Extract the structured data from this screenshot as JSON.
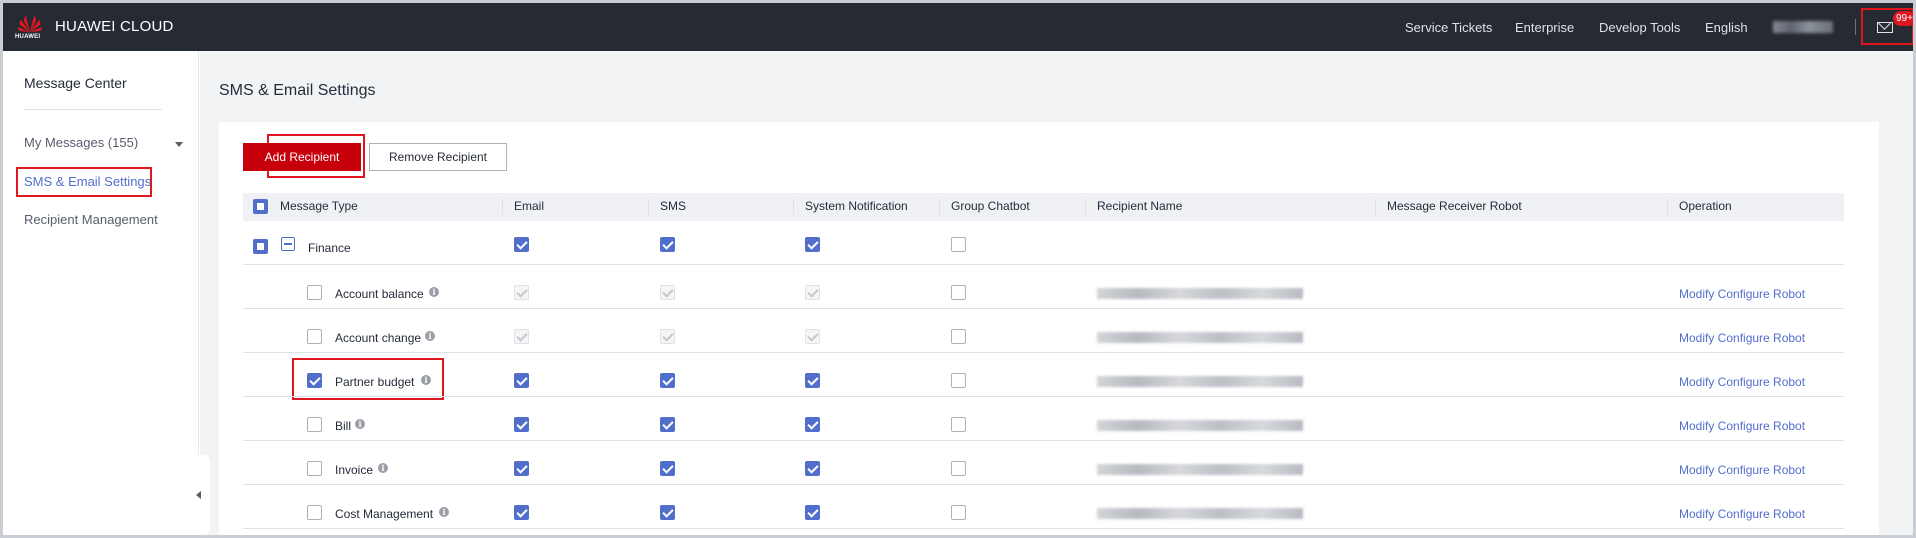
{
  "topbar": {
    "brand": "HUAWEI CLOUD",
    "logo_sub": "HUAWEI",
    "nav": [
      "Service Tickets",
      "Enterprise",
      "Develop Tools",
      "English"
    ],
    "mail_badge": "99+"
  },
  "sidebar": {
    "title": "Message Center",
    "items": [
      {
        "label": "My Messages (155)"
      },
      {
        "label": "SMS & Email Settings"
      },
      {
        "label": "Recipient Management"
      }
    ]
  },
  "main": {
    "title": "SMS & Email Settings",
    "add_button": "Add Recipient",
    "remove_button": "Remove Recipient"
  },
  "table": {
    "headers": [
      "Message Type",
      "Email",
      "SMS",
      "System Notification",
      "Group Chatbot",
      "Recipient Name",
      "Message Receiver Robot",
      "Operation"
    ],
    "group": {
      "label": "Finance"
    },
    "rows": [
      {
        "label": "Account balance",
        "operation": "Modify Configure Robot"
      },
      {
        "label": "Account change",
        "operation": "Modify Configure Robot"
      },
      {
        "label": "Partner budget",
        "operation": "Modify Configure Robot"
      },
      {
        "label": "Bill",
        "operation": "Modify Configure Robot"
      },
      {
        "label": "Invoice",
        "operation": "Modify Configure Robot"
      },
      {
        "label": "Cost Management",
        "operation": "Modify Configure Robot"
      }
    ]
  },
  "colors": {
    "topbar_bg": "#262a33",
    "primary_red": "#c7000b",
    "highlight_red": "#e0161f",
    "link_blue": "#526ecc"
  },
  "icons": [
    "huawei-logo-icon",
    "mail-icon",
    "caret-down-icon",
    "collapse-left-icon",
    "info-icon",
    "collapse-minus-icon"
  ]
}
